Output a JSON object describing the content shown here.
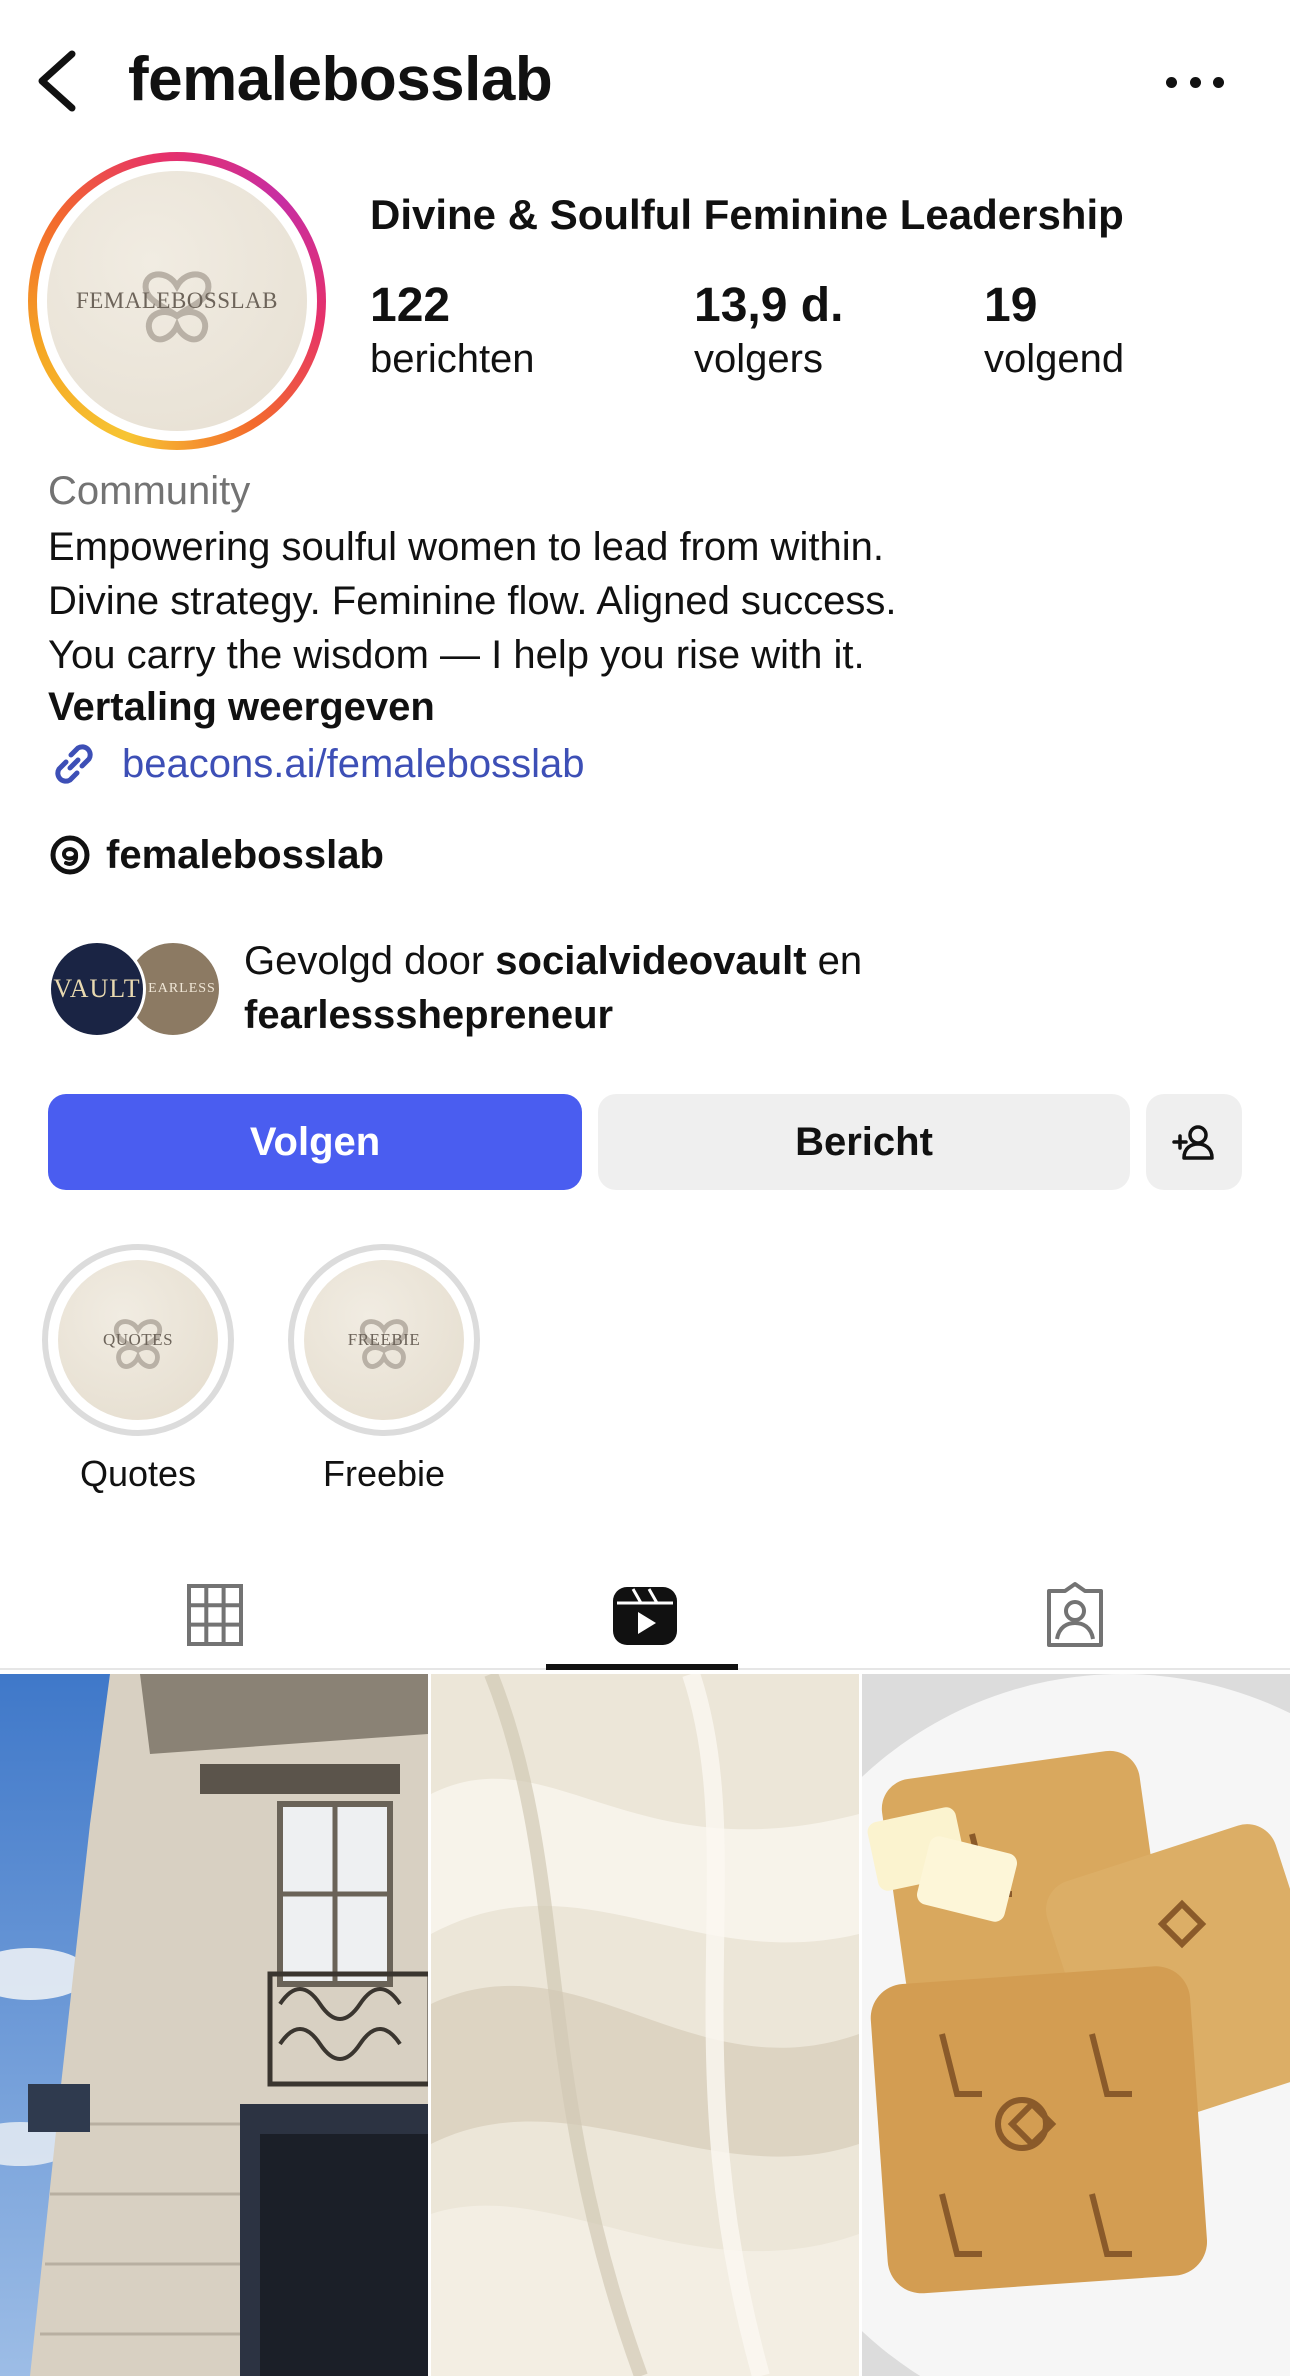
{
  "header": {
    "username": "femalebosslab"
  },
  "profile": {
    "avatar_text": "FEMALEBOSSLAB",
    "display_name": "Divine & Soulful Feminine Leadership",
    "stats": {
      "posts": {
        "value": "122",
        "label": "berichten"
      },
      "followers": {
        "value": "13,9 d.",
        "label": "volgers"
      },
      "following": {
        "value": "19",
        "label": "volgend"
      }
    },
    "category": "Community",
    "bio_lines": [
      "Empowering soulful women to lead from within.",
      "Divine strategy. Feminine flow. Aligned success.",
      "You carry the wisdom — I help you rise with it."
    ],
    "translate_label": "Vertaling weergeven",
    "link": "beacons.ai/femalebosslab",
    "threads_handle": "femalebosslab"
  },
  "followed_by": {
    "prefix": "Gevolgd door",
    "user1": "socialvideovault",
    "joiner": "en",
    "user2": "fearlessshepreneur",
    "avatar1_text": "VAULT",
    "avatar2_text": "EARLESS"
  },
  "actions": {
    "follow": "Volgen",
    "message": "Bericht"
  },
  "highlights": [
    {
      "label": "Quotes",
      "cover_text": "QUOTES"
    },
    {
      "label": "Freebie",
      "cover_text": "FREEBIE"
    }
  ],
  "tabs": {
    "active": "reels"
  },
  "colors": {
    "primary_button": "#4a5df0",
    "link": "#3d4fb6",
    "secondary_button": "#efefef"
  }
}
